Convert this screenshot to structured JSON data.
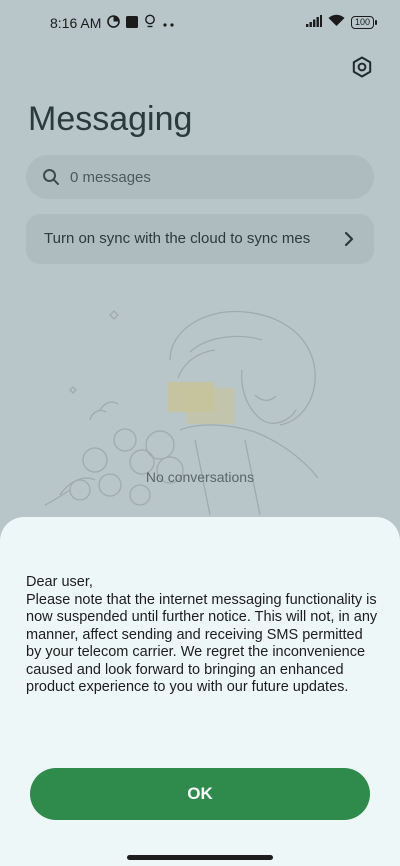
{
  "status_bar": {
    "time": "8:16 AM",
    "battery": "100",
    "left_icons": [
      "data-saver-icon",
      "stop-square-icon",
      "location-bulb-icon",
      "more-dots-icon"
    ],
    "right_icons": [
      "signal-icon",
      "wifi-icon",
      "battery-icon"
    ]
  },
  "header": {
    "title": "Messaging",
    "settings_icon": "gear-hex-icon"
  },
  "search": {
    "placeholder": "0 messages"
  },
  "sync_banner": {
    "text": "Turn on sync with the cloud to sync messages"
  },
  "empty_state": {
    "text": "No conversations"
  },
  "dialog": {
    "lines": [
      "Dear user,",
      "Please note that the internet messaging functionality is now suspended until further notice. This will not, in any manner, affect sending and receiving SMS permitted by your telecom carrier. We regret the inconvenience caused and look forward to bringing an enhanced product experience to you with our future updates."
    ],
    "ok_label": "OK"
  },
  "colors": {
    "overlay_bg": "#b8c6c9",
    "sheet_bg": "#eef7f8",
    "ok_button": "#2e8b4b"
  }
}
